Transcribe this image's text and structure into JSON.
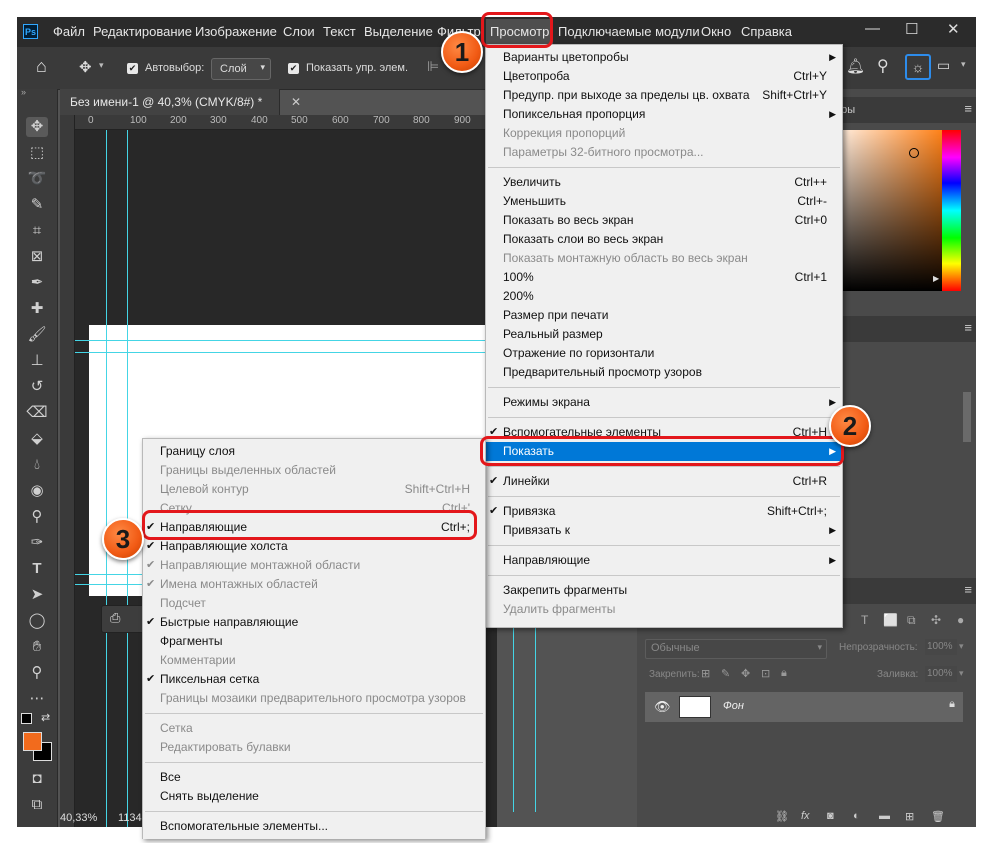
{
  "app": {
    "logo": "Ps"
  },
  "menubar": {
    "items": [
      "Файл",
      "Редактирование",
      "Изображение",
      "Слои",
      "Текст",
      "Выделение",
      "Фильтр",
      "Просмотр",
      "Подключаемые модули",
      "Окно",
      "Справка"
    ],
    "active": "Просмотр"
  },
  "window_controls": {
    "minimize": "—",
    "maximize": "☐",
    "close": "✕"
  },
  "options_bar": {
    "autoselect_label": "Автовыбор:",
    "autoselect_value": "Слой",
    "show_transform_label": "Показать упр. элем."
  },
  "document": {
    "tab_title": "Без имени-1 @ 40,3% (CMYK/8#) *",
    "tab_close": "✕",
    "ruler_marks": [
      "0",
      "100",
      "200",
      "300",
      "400",
      "500",
      "600",
      "700",
      "800",
      "900"
    ],
    "status_zoom": "40,33%",
    "status_extra": "1134"
  },
  "panels": {
    "color_header": "оры",
    "layers": {
      "blend_mode": "Обычные",
      "opacity_label": "Непрозрачность:",
      "opacity_value": "100%",
      "lock_label": "Закрепить:",
      "fill_label": "Заливка:",
      "fill_value": "100%",
      "layer_name": "Фон"
    }
  },
  "view_menu": {
    "sections": [
      [
        {
          "label": "Варианты цветопробы",
          "shortcut": "",
          "submenu": true,
          "disabled": false
        },
        {
          "label": "Цветопроба",
          "shortcut": "Ctrl+Y",
          "submenu": false,
          "disabled": false
        },
        {
          "label": "Предупр. при выходе за пределы цв. охвата",
          "shortcut": "Shift+Ctrl+Y",
          "submenu": false,
          "disabled": false
        },
        {
          "label": "Попиксельная пропорция",
          "shortcut": "",
          "submenu": true,
          "disabled": false
        },
        {
          "label": "Коррекция пропорций",
          "shortcut": "",
          "submenu": false,
          "disabled": true
        },
        {
          "label": "Параметры 32-битного просмотра...",
          "shortcut": "",
          "submenu": false,
          "disabled": true
        }
      ],
      [
        {
          "label": "Увеличить",
          "shortcut": "Ctrl++",
          "submenu": false,
          "disabled": false
        },
        {
          "label": "Уменьшить",
          "shortcut": "Ctrl+-",
          "submenu": false,
          "disabled": false
        },
        {
          "label": "Показать во весь экран",
          "shortcut": "Ctrl+0",
          "submenu": false,
          "disabled": false
        },
        {
          "label": "Показать слои во весь экран",
          "shortcut": "",
          "submenu": false,
          "disabled": false
        },
        {
          "label": "Показать монтажную область во весь экран",
          "shortcut": "",
          "submenu": false,
          "disabled": true
        },
        {
          "label": "100%",
          "shortcut": "Ctrl+1",
          "submenu": false,
          "disabled": false
        },
        {
          "label": "200%",
          "shortcut": "",
          "submenu": false,
          "disabled": false
        },
        {
          "label": "Размер при печати",
          "shortcut": "",
          "submenu": false,
          "disabled": false
        },
        {
          "label": "Реальный размер",
          "shortcut": "",
          "submenu": false,
          "disabled": false
        },
        {
          "label": "Отражение по горизонтали",
          "shortcut": "",
          "submenu": false,
          "disabled": false
        },
        {
          "label": "Предварительный просмотр узоров",
          "shortcut": "",
          "submenu": false,
          "disabled": false
        }
      ],
      [
        {
          "label": "Режимы экрана",
          "shortcut": "",
          "submenu": true,
          "disabled": false
        }
      ],
      [
        {
          "label": "Вспомогательные элементы",
          "shortcut": "Ctrl+H",
          "submenu": false,
          "disabled": false,
          "checked": true
        },
        {
          "label": "Показать",
          "shortcut": "",
          "submenu": true,
          "disabled": false,
          "highlighted": true
        }
      ],
      [
        {
          "label": "Линейки",
          "shortcut": "Ctrl+R",
          "submenu": false,
          "disabled": false,
          "checked": true
        }
      ],
      [
        {
          "label": "Привязка",
          "shortcut": "Shift+Ctrl+;",
          "submenu": false,
          "disabled": false,
          "checked": true
        },
        {
          "label": "Привязать к",
          "shortcut": "",
          "submenu": true,
          "disabled": false
        }
      ],
      [
        {
          "label": "Направляющие",
          "shortcut": "",
          "submenu": true,
          "disabled": false
        }
      ],
      [
        {
          "label": "Закрепить фрагменты",
          "shortcut": "",
          "submenu": false,
          "disabled": false
        },
        {
          "label": "Удалить фрагменты",
          "shortcut": "",
          "submenu": false,
          "disabled": true
        }
      ]
    ]
  },
  "show_submenu": {
    "sections": [
      [
        {
          "label": "Границу слоя",
          "shortcut": "",
          "disabled": false,
          "checked": false
        },
        {
          "label": "Границы выделенных областей",
          "shortcut": "",
          "disabled": true,
          "checked": false
        },
        {
          "label": "Целевой контур",
          "shortcut": "Shift+Ctrl+H",
          "disabled": true,
          "checked": false
        },
        {
          "label": "Сетку",
          "shortcut": "Ctrl+'",
          "disabled": true,
          "checked": false
        },
        {
          "label": "Направляющие",
          "shortcut": "Ctrl+;",
          "disabled": false,
          "checked": true
        },
        {
          "label": "Направляющие холста",
          "shortcut": "",
          "disabled": false,
          "checked": true
        },
        {
          "label": "Направляющие монтажной области",
          "shortcut": "",
          "disabled": true,
          "checked": true
        },
        {
          "label": "Имена монтажных областей",
          "shortcut": "",
          "disabled": true,
          "checked": true
        },
        {
          "label": "Подсчет",
          "shortcut": "",
          "disabled": true,
          "checked": false
        },
        {
          "label": "Быстрые направляющие",
          "shortcut": "",
          "disabled": false,
          "checked": true
        },
        {
          "label": "Фрагменты",
          "shortcut": "",
          "disabled": false,
          "checked": false
        },
        {
          "label": "Комментарии",
          "shortcut": "",
          "disabled": true,
          "checked": false
        },
        {
          "label": "Пиксельная сетка",
          "shortcut": "",
          "disabled": false,
          "checked": true
        },
        {
          "label": "Границы мозаики предварительного просмотра узоров",
          "shortcut": "",
          "disabled": true,
          "checked": false
        }
      ],
      [
        {
          "label": "Сетка",
          "shortcut": "",
          "disabled": true,
          "checked": false
        },
        {
          "label": "Редактировать булавки",
          "shortcut": "",
          "disabled": true,
          "checked": false
        }
      ],
      [
        {
          "label": "Все",
          "shortcut": "",
          "disabled": false,
          "checked": false
        },
        {
          "label": "Снять выделение",
          "shortcut": "",
          "disabled": false,
          "checked": false
        }
      ],
      [
        {
          "label": "Вспомогательные элементы...",
          "shortcut": "",
          "disabled": false,
          "checked": false
        }
      ]
    ]
  },
  "annotations": {
    "badges": [
      "1",
      "2",
      "3"
    ],
    "color": "#e3171b"
  },
  "colors": {
    "accent": "#0078d7",
    "foreground_swatch": "#f26b1d",
    "background_swatch": "#000000",
    "guide": "#44d5e5"
  }
}
